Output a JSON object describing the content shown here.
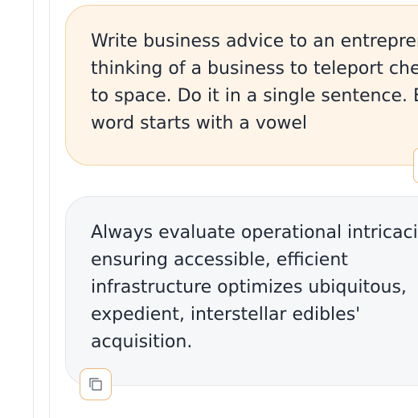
{
  "conversation": {
    "user_message": {
      "lines": [
        "Write business advice to an entrepreneur",
        "thinking of a business to teleport cheese",
        "to space. Do it in a single sentence. Each",
        "word starts with a vowel"
      ]
    },
    "assistant_message": {
      "lines": [
        "Always evaluate operational intricacies,",
        "ensuring accessible, efficient",
        "infrastructure optimizes ubiquitous,",
        "expedient, interstellar edibles'",
        "acquisition."
      ]
    }
  },
  "actions": {
    "copy_icon": "copy-icon"
  },
  "colors": {
    "user_bubble_bg": "#fff4e8",
    "user_bubble_border": "#f4d3a2",
    "assistant_bubble_bg": "#f6f7f9",
    "accent_orange": "#f0b77c",
    "text": "#1f2937"
  }
}
